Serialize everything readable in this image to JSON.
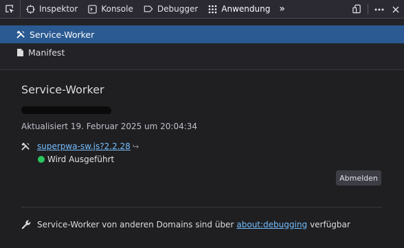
{
  "toolbar": {
    "tabs": [
      {
        "label": "Inspektor",
        "icon": "inspector-icon"
      },
      {
        "label": "Konsole",
        "icon": "console-icon"
      },
      {
        "label": "Debugger",
        "icon": "debugger-icon"
      },
      {
        "label": "Anwendung",
        "icon": "application-icon",
        "active": true
      }
    ],
    "overflow": "»"
  },
  "sidebar": {
    "items": [
      {
        "label": "Service-Worker",
        "icon": "tools-icon",
        "selected": true
      },
      {
        "label": "Manifest",
        "icon": "file-icon",
        "selected": false
      }
    ]
  },
  "main": {
    "title": "Service-Worker",
    "updated": "Aktualisiert 19. Februar 2025 um 20:04:34",
    "worker_link": "superpwa-sw.js?2.2.28",
    "status": "Wird Ausgeführt",
    "unregister_label": "Abmelden",
    "footer_prefix": "Service-Worker von anderen Domains sind über",
    "footer_link": "about:debugging",
    "footer_suffix": "verfügbar"
  },
  "colors": {
    "accent": "#2a5a91",
    "link": "#75bfff",
    "status_running": "#2ac65e"
  }
}
